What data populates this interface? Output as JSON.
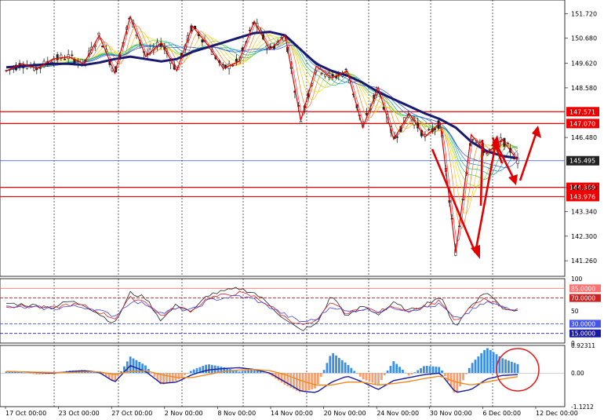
{
  "chart_data": [
    {
      "type": "candlestick",
      "title": "",
      "ylim": [
        140.6,
        152.3
      ],
      "y_ticks": [
        "151.720",
        "150.680",
        "149.620",
        "148.580",
        "146.480",
        "145.495",
        "144.360",
        "143.340",
        "142.300",
        "141.260"
      ],
      "price_levels": [
        {
          "label": "147.571",
          "value": 147.571,
          "color": "#ee0000"
        },
        {
          "label": "147.070",
          "value": 147.07,
          "color": "#ee0000"
        },
        {
          "label": "144.369",
          "value": 144.369,
          "color": "#ee0000"
        },
        {
          "label": "143.976",
          "value": 143.976,
          "color": "#ee0000"
        }
      ],
      "current_price": {
        "label": "145.495",
        "value": 145.495,
        "color": "#3355cc"
      },
      "zigzag": [
        149.3,
        149.6,
        149.4,
        149.8,
        149.9,
        149.6,
        150.8,
        149.2,
        151.6,
        149.9,
        150.5,
        149.3,
        151.2,
        150.4,
        149.4,
        149.7,
        151.4,
        150.2,
        150.8,
        147.2,
        149.5,
        149.0,
        149.3,
        146.9,
        148.6,
        146.4,
        147.5,
        146.5,
        147.1,
        141.6,
        146.6,
        145.8,
        146.4,
        145.5
      ],
      "moving_average": [
        149.45,
        149.5,
        149.55,
        149.6,
        149.6,
        149.55,
        149.65,
        149.8,
        149.9,
        149.8,
        149.7,
        149.8,
        150.1,
        150.3,
        150.5,
        150.7,
        150.9,
        150.95,
        150.8,
        150.2,
        149.6,
        149.3,
        149.1,
        148.8,
        148.4,
        148.1,
        147.8,
        147.5,
        147.25,
        146.9,
        146.3,
        145.9,
        145.7,
        145.6
      ],
      "projection_arrows": 4
    },
    {
      "type": "line",
      "ylim": [
        0,
        100
      ],
      "y_ticks": [
        "100",
        "85.0000",
        "70.0000",
        "50",
        "30.0000",
        "15.0000",
        "0"
      ],
      "levels": [
        {
          "label": "85.0000",
          "value": 85,
          "color": "#ff7070"
        },
        {
          "label": "70.0000",
          "value": 70,
          "color": "#cc2222"
        },
        {
          "label": "30.0000",
          "value": 30,
          "color": "#4455ee"
        },
        {
          "label": "15.0000",
          "value": 15,
          "color": "#1a1aa0"
        }
      ],
      "series": [
        {
          "values": [
            62,
            60,
            58,
            55,
            65,
            60,
            45,
            30,
            78,
            70,
            35,
            60,
            48,
            75,
            80,
            85,
            78,
            60,
            35,
            20,
            28,
            75,
            40,
            58,
            45,
            62,
            50,
            60,
            72,
            25,
            60,
            80,
            55,
            50
          ],
          "color": "#222222"
        },
        {
          "values": [
            58,
            57,
            56,
            54,
            60,
            58,
            48,
            38,
            70,
            65,
            42,
            56,
            50,
            70,
            74,
            78,
            72,
            58,
            40,
            28,
            32,
            65,
            45,
            55,
            48,
            58,
            50,
            57,
            65,
            32,
            55,
            70,
            56,
            52
          ],
          "color": "#dd2222"
        },
        {
          "values": [
            56,
            55,
            55,
            53,
            57,
            56,
            50,
            42,
            64,
            61,
            46,
            53,
            51,
            66,
            70,
            73,
            68,
            56,
            44,
            33,
            36,
            58,
            48,
            53,
            49,
            55,
            51,
            55,
            60,
            36,
            50,
            64,
            56,
            53
          ],
          "color": "#4444dd"
        }
      ]
    },
    {
      "type": "bar",
      "ylim": [
        -1.1212,
        0.92311
      ],
      "y_ticks": [
        "0.92311",
        "0.00",
        "-1.1212"
      ],
      "histogram": [
        0.05,
        0.02,
        -0.05,
        -0.03,
        0.08,
        0.1,
        0.05,
        -0.3,
        0.55,
        0.25,
        -0.4,
        -0.25,
        0.1,
        0.3,
        0.2,
        0.05,
        0.12,
        -0.05,
        -0.4,
        -0.65,
        -0.5,
        0.7,
        0.3,
        -0.2,
        -0.4,
        0.4,
        -0.1,
        0.25,
        0.2,
        -0.75,
        0.3,
        0.85,
        0.5,
        0.3
      ],
      "series": [
        {
          "values": [
            0.05,
            0.04,
            0.02,
            0.0,
            0.04,
            0.08,
            0.02,
            -0.3,
            0.25,
            0.05,
            -0.35,
            -0.3,
            -0.05,
            0.1,
            0.15,
            0.18,
            0.12,
            0.0,
            -0.3,
            -0.6,
            -0.65,
            -0.3,
            -0.1,
            -0.3,
            -0.55,
            -0.25,
            -0.15,
            -0.05,
            0.0,
            -0.65,
            -0.55,
            -0.2,
            -0.08,
            -0.05
          ],
          "color": "#1a1aa0"
        },
        {
          "values": [
            0.05,
            0.04,
            0.03,
            0.02,
            0.02,
            0.04,
            0.04,
            -0.05,
            0.05,
            0.08,
            -0.05,
            -0.15,
            -0.15,
            -0.05,
            0.05,
            0.1,
            0.12,
            0.08,
            -0.05,
            -0.25,
            -0.4,
            -0.4,
            -0.3,
            -0.3,
            -0.4,
            -0.35,
            -0.28,
            -0.18,
            -0.1,
            -0.3,
            -0.4,
            -0.3,
            -0.2,
            -0.12
          ],
          "color": "#f08a20"
        }
      ],
      "highlight": "circle"
    }
  ],
  "x_labels": [
    "17 Oct 00:00",
    "23 Oct 00:00",
    "27 Oct 00:00",
    "2 Nov 00:00",
    "8 Nov 00:00",
    "14 Nov 00:00",
    "20 Nov 00:00",
    "24 Nov 00:00",
    "30 Nov 00:00",
    "6 Dec 00:00",
    "12 Dec 00:00"
  ],
  "colors": {
    "up": "#222222",
    "grid": "#000000",
    "level": "#ee0000",
    "hist_pos": "#3a8ee6",
    "hist_neg": "#f5a070",
    "highlight": "#e02020"
  }
}
